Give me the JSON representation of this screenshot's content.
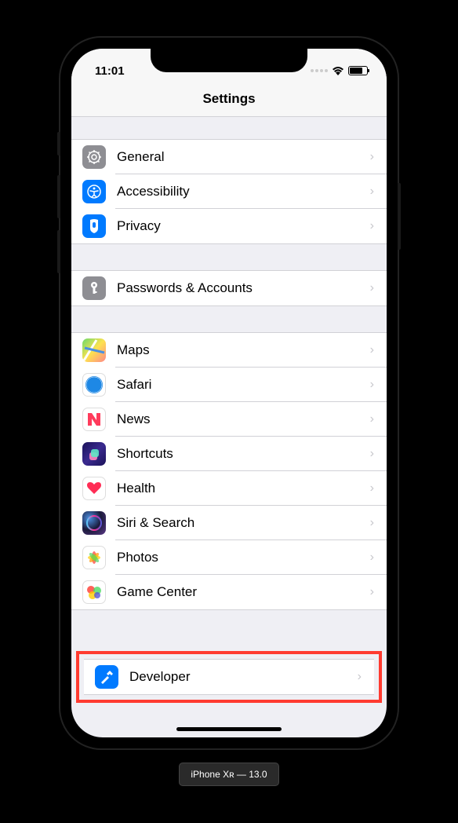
{
  "status": {
    "time": "11:01"
  },
  "header": {
    "title": "Settings"
  },
  "sections": [
    {
      "rows": [
        {
          "icon": "general",
          "label": "General"
        },
        {
          "icon": "accessibility",
          "label": "Accessibility"
        },
        {
          "icon": "privacy",
          "label": "Privacy"
        }
      ]
    },
    {
      "rows": [
        {
          "icon": "passwords",
          "label": "Passwords & Accounts"
        }
      ]
    },
    {
      "rows": [
        {
          "icon": "maps",
          "label": "Maps"
        },
        {
          "icon": "safari",
          "label": "Safari"
        },
        {
          "icon": "news",
          "label": "News"
        },
        {
          "icon": "shortcuts",
          "label": "Shortcuts"
        },
        {
          "icon": "health",
          "label": "Health"
        },
        {
          "icon": "siri",
          "label": "Siri & Search"
        },
        {
          "icon": "photos",
          "label": "Photos"
        },
        {
          "icon": "gamecenter",
          "label": "Game Center"
        }
      ]
    }
  ],
  "highlighted": {
    "icon": "developer",
    "label": "Developer"
  },
  "device_label": "iPhone Xʀ — 13.0"
}
